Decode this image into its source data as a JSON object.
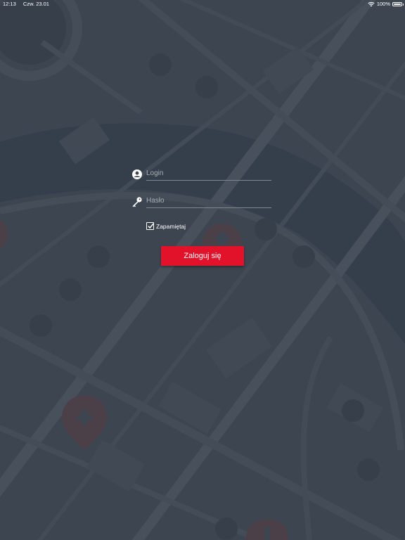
{
  "status_bar": {
    "time": "12:13",
    "date": "Czw. 23.01",
    "battery": "100%",
    "battery_level": 1.0,
    "icons": [
      "wifi-icon",
      "battery-icon"
    ]
  },
  "login": {
    "login_placeholder": "Login",
    "login_value": "",
    "password_placeholder": "Hasło",
    "password_value": "",
    "remember_label": "Zapamiętaj",
    "remember_checked": true,
    "submit_label": "Zaloguj się",
    "icons": [
      "user-icon",
      "key-icon",
      "checkmark-icon"
    ]
  },
  "colors": {
    "background": "#3c4550",
    "map_road": "#4a535d",
    "map_river": "#343e4a",
    "accent": "#e2122a",
    "text": "#ffffff",
    "placeholder": "#a7aeb5"
  }
}
